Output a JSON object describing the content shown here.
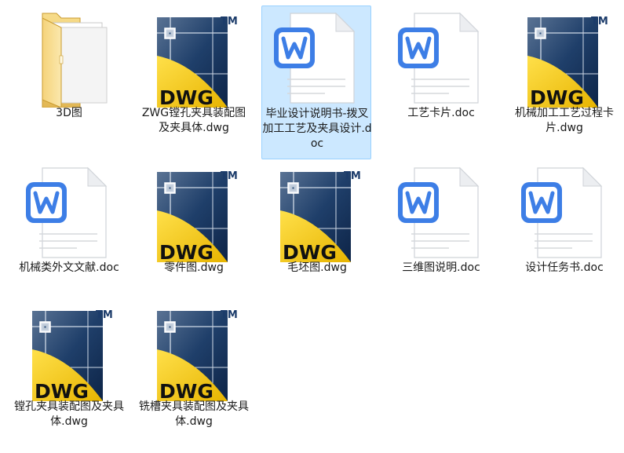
{
  "colors": {
    "selection_bg": "#cce8ff",
    "selection_border": "#99d1ff",
    "dwg_yellow": "#f2c60f",
    "dwg_blue": "#1c3f6d",
    "word_blue": "#3d7ee6"
  },
  "files": [
    {
      "name": "3D图",
      "type": "folder",
      "icon": "folder-icon"
    },
    {
      "name": "ZWG镗孔夹具装配图及夹具体.dwg",
      "type": "dwg",
      "icon": "dwg-file-icon"
    },
    {
      "name": "毕业设计说明书-拨叉加工工艺及夹具设计.doc",
      "type": "doc",
      "icon": "word-doc-icon",
      "selected": true
    },
    {
      "name": "工艺卡片.doc",
      "type": "doc",
      "icon": "word-doc-icon"
    },
    {
      "name": "机械加工工艺过程卡片.dwg",
      "type": "dwg",
      "icon": "dwg-file-icon"
    },
    {
      "name": "机械类外文文献.doc",
      "type": "doc",
      "icon": "word-doc-icon"
    },
    {
      "name": "零件图.dwg",
      "type": "dwg",
      "icon": "dwg-file-icon"
    },
    {
      "name": "毛坯图.dwg",
      "type": "dwg",
      "icon": "dwg-file-icon"
    },
    {
      "name": "三维图说明.doc",
      "type": "doc",
      "icon": "word-doc-icon"
    },
    {
      "name": "设计任务书.doc",
      "type": "doc",
      "icon": "word-doc-icon"
    },
    {
      "name": "镗孔夹具装配图及夹具体.dwg",
      "type": "dwg",
      "icon": "dwg-file-icon"
    },
    {
      "name": "铣槽夹具装配图及夹具体.dwg",
      "type": "dwg",
      "icon": "dwg-file-icon"
    }
  ],
  "dwg_badge": {
    "text": "DWG",
    "trademark": "TM"
  }
}
